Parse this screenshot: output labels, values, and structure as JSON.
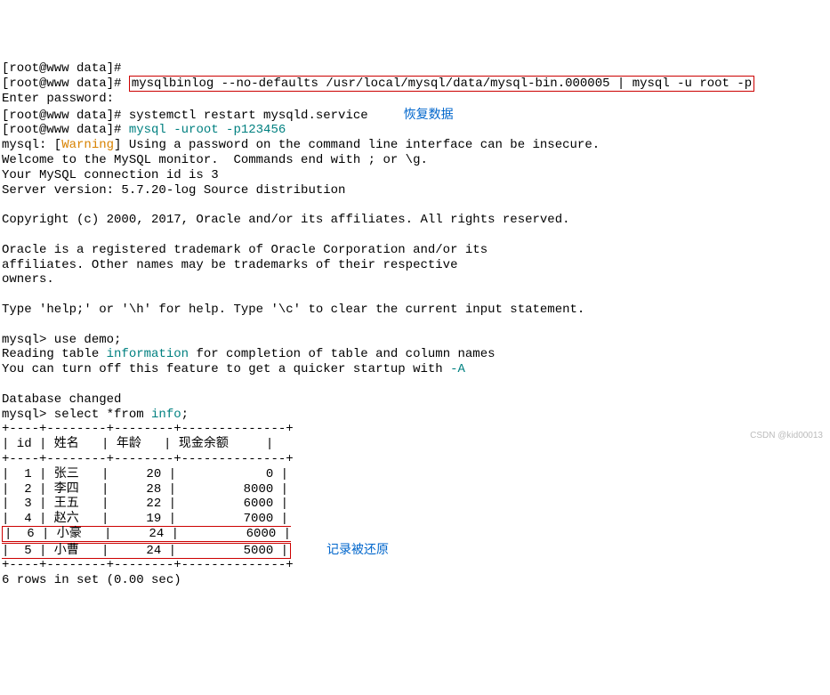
{
  "lines": {
    "l0": "[root@www data]# ",
    "l1": "[root@www data]# ",
    "cmd1": "mysqlbinlog --no-defaults /usr/local/mysql/data/mysql-bin.000005 | mysql -u root -p",
    "l2": "Enter password:",
    "l3": "[root@www data]# systemctl restart mysqld.service",
    "l4_prompt": "[root@www data]# ",
    "l4_cmd": "mysql -uroot -p123456",
    "annotation1": "恢复数据",
    "l5a": "mysql: [",
    "l5b": "Warning",
    "l5c": "] Using a password on the command line interface can be insecure.",
    "l6": "Welcome to the MySQL monitor.  Commands end with ; or \\g.",
    "l7": "Your MySQL connection id is 3",
    "l8": "Server version: 5.7.20-log Source distribution",
    "l9": "Copyright (c) 2000, 2017, Oracle and/or its affiliates. All rights reserved.",
    "l10": "Oracle is a registered trademark of Oracle Corporation and/or its",
    "l11": "affiliates. Other names may be trademarks of their respective",
    "l12": "owners.",
    "l13": "Type 'help;' or '\\h' for help. Type '\\c' to clear the current input statement.",
    "l14": "mysql> use demo;",
    "l15a": "Reading table ",
    "l15b": "information",
    "l15c": " for completion of table and column names",
    "l16a": "You can turn off this feature to get a quicker startup with ",
    "l16b": "-A",
    "l17": "Database changed",
    "l18a": "mysql> select *from ",
    "l18b": "info",
    "l18c": ";",
    "tbord": "+----+--------+--------+--------------+",
    "thead": "| id | 姓名   | 年龄   | 现金余额     |",
    "r1": "|  1 | 张三   |     20 |            0 |",
    "r2": "|  2 | 李四   |     28 |         8000 |",
    "r3": "|  3 | 王五   |     22 |         6000 |",
    "r4": "|  4 | 赵六   |     19 |         7000 |",
    "r5": "|  6 | 小豪   |     24 |         6000 |",
    "r6": "|  5 | 小曹   |     24 |         5000 |",
    "annotation2": "记录被还原",
    "foot": "6 rows in set (0.00 sec)",
    "watermark": "CSDN @kid00013"
  }
}
